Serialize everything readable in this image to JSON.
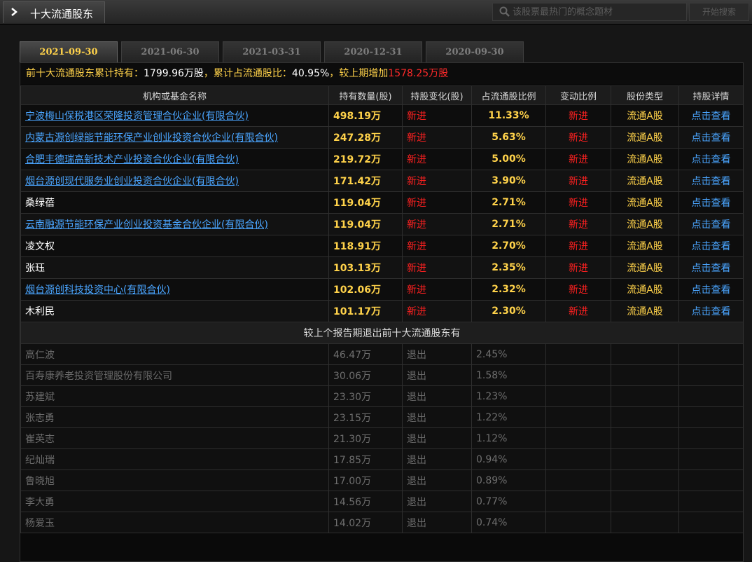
{
  "header": {
    "title": "十大流通股东",
    "search_placeholder": "该股票最热门的概念题材",
    "search_button": "开始搜索"
  },
  "tabs": [
    {
      "label": "2021-09-30",
      "active": true
    },
    {
      "label": "2021-06-30",
      "active": false
    },
    {
      "label": "2021-03-31",
      "active": false
    },
    {
      "label": "2020-12-31",
      "active": false
    },
    {
      "label": "2020-09-30",
      "active": false
    }
  ],
  "summary": {
    "prefix": "前十大流通股东累计持有：",
    "total": "1799.96万股",
    "mid": "，累计占流通股比：",
    "ratio": "40.95%",
    "mid2": "，较上期增加",
    "increase": "1578.25万股"
  },
  "columns": [
    "机构或基金名称",
    "持有数量(股)",
    "持股变化(股)",
    "占流通股比例",
    "变动比例",
    "股份类型",
    "持股详情"
  ],
  "holders": [
    {
      "name": "宁波梅山保税港区荣隆投资管理合伙企业(有限合伙)",
      "link": true,
      "qty": "498.19万",
      "change": "新进",
      "ratio": "11.33%",
      "change_ratio": "新进",
      "type": "流通A股",
      "detail": "点击查看"
    },
    {
      "name": "内蒙古源创绿能节能环保产业创业投资合伙企业(有限合伙)",
      "link": true,
      "qty": "247.28万",
      "change": "新进",
      "ratio": "5.63%",
      "change_ratio": "新进",
      "type": "流通A股",
      "detail": "点击查看"
    },
    {
      "name": "合肥丰德瑞高新技术产业投资合伙企业(有限合伙)",
      "link": true,
      "qty": "219.72万",
      "change": "新进",
      "ratio": "5.00%",
      "change_ratio": "新进",
      "type": "流通A股",
      "detail": "点击查看"
    },
    {
      "name": "烟台源创现代服务业创业投资合伙企业(有限合伙)",
      "link": true,
      "qty": "171.42万",
      "change": "新进",
      "ratio": "3.90%",
      "change_ratio": "新进",
      "type": "流通A股",
      "detail": "点击查看"
    },
    {
      "name": "桑绿蓓",
      "link": false,
      "qty": "119.04万",
      "change": "新进",
      "ratio": "2.71%",
      "change_ratio": "新进",
      "type": "流通A股",
      "detail": "点击查看"
    },
    {
      "name": "云南融源节能环保产业创业投资基金合伙企业(有限合伙)",
      "link": true,
      "qty": "119.04万",
      "change": "新进",
      "ratio": "2.71%",
      "change_ratio": "新进",
      "type": "流通A股",
      "detail": "点击查看"
    },
    {
      "name": "凌文权",
      "link": false,
      "qty": "118.91万",
      "change": "新进",
      "ratio": "2.70%",
      "change_ratio": "新进",
      "type": "流通A股",
      "detail": "点击查看"
    },
    {
      "name": "张珏",
      "link": false,
      "qty": "103.13万",
      "change": "新进",
      "ratio": "2.35%",
      "change_ratio": "新进",
      "type": "流通A股",
      "detail": "点击查看"
    },
    {
      "name": "烟台源创科技投资中心(有限合伙)",
      "link": true,
      "qty": "102.06万",
      "change": "新进",
      "ratio": "2.32%",
      "change_ratio": "新进",
      "type": "流通A股",
      "detail": "点击查看"
    },
    {
      "name": "木利民",
      "link": false,
      "qty": "101.17万",
      "change": "新进",
      "ratio": "2.30%",
      "change_ratio": "新进",
      "type": "流通A股",
      "detail": "点击查看"
    }
  ],
  "exited_section_title": "较上个报告期退出前十大流通股东有",
  "exited": [
    {
      "name": "高仁波",
      "qty": "46.47万",
      "change": "退出",
      "ratio": "2.45%"
    },
    {
      "name": "百寿康养老投资管理股份有限公司",
      "qty": "30.06万",
      "change": "退出",
      "ratio": "1.58%"
    },
    {
      "name": "苏建斌",
      "qty": "23.30万",
      "change": "退出",
      "ratio": "1.23%"
    },
    {
      "name": "张志勇",
      "qty": "23.15万",
      "change": "退出",
      "ratio": "1.22%"
    },
    {
      "name": "崔英志",
      "qty": "21.30万",
      "change": "退出",
      "ratio": "1.12%"
    },
    {
      "name": "纪灿瑞",
      "qty": "17.85万",
      "change": "退出",
      "ratio": "0.94%"
    },
    {
      "name": "鲁晓旭",
      "qty": "17.00万",
      "change": "退出",
      "ratio": "0.89%"
    },
    {
      "name": "李大勇",
      "qty": "14.56万",
      "change": "退出",
      "ratio": "0.77%"
    },
    {
      "name": "杨爱玉",
      "qty": "14.02万",
      "change": "退出",
      "ratio": "0.74%"
    }
  ]
}
